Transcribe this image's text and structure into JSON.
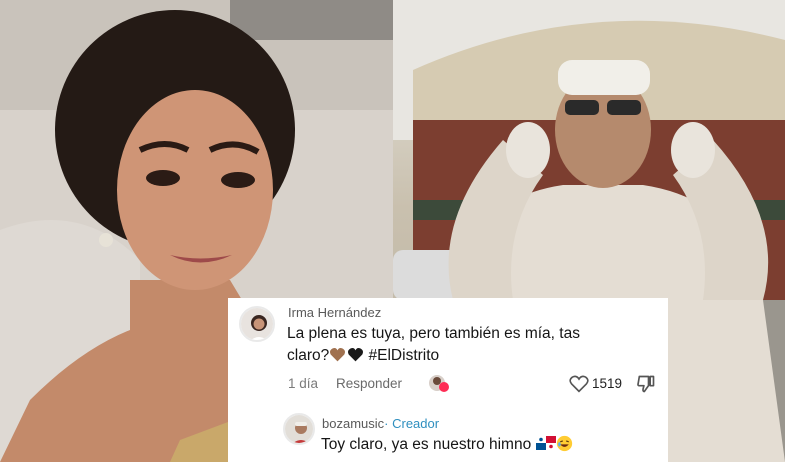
{
  "comments": [
    {
      "username": "Irma Hernández",
      "text_line1": "La plena es tuya, pero también es mía, tas",
      "text_line2": "claro?",
      "hashtag": "#ElDistrito",
      "time": "1 día",
      "reply_label": "Responder",
      "likes": "1519",
      "icons": [
        "heart-outline-icon",
        "thumbs-down-icon",
        "reaction-avatar-icon",
        "brown-heart-emoji",
        "black-heart-emoji"
      ]
    },
    {
      "username": "bozamusic",
      "separator": "·",
      "badge": "Creador",
      "text": "Toy claro, ya es nuestro himno",
      "icons": [
        "panama-flag-emoji",
        "laughing-emoji"
      ]
    }
  ],
  "colors": {
    "creator_badge": "#2f8fbf",
    "heart_brown": "#a0714f",
    "heart_black": "#1a1a1a"
  }
}
